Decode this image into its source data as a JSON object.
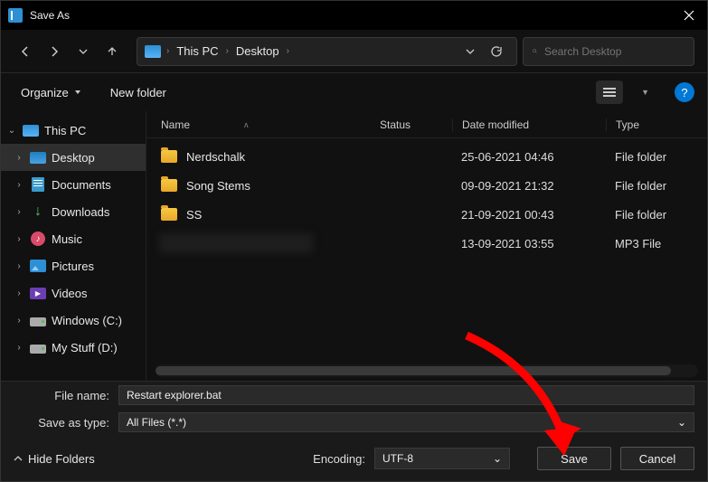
{
  "titlebar": {
    "title": "Save As"
  },
  "nav": {
    "path_seg1": "This PC",
    "path_seg2": "Desktop",
    "search_placeholder": "Search Desktop"
  },
  "toolbar": {
    "organize": "Organize",
    "newfolder": "New folder"
  },
  "sidebar": {
    "items": [
      {
        "label": "This PC"
      },
      {
        "label": "Desktop"
      },
      {
        "label": "Documents"
      },
      {
        "label": "Downloads"
      },
      {
        "label": "Music"
      },
      {
        "label": "Pictures"
      },
      {
        "label": "Videos"
      },
      {
        "label": "Windows (C:)"
      },
      {
        "label": "My Stuff (D:)"
      }
    ]
  },
  "columns": {
    "name": "Name",
    "status": "Status",
    "date": "Date modified",
    "type": "Type"
  },
  "files": [
    {
      "name": "Nerdschalk",
      "date": "25-06-2021 04:46",
      "type": "File folder",
      "icon": "folder"
    },
    {
      "name": "Song Stems",
      "date": "09-09-2021 21:32",
      "type": "File folder",
      "icon": "folder"
    },
    {
      "name": "SS",
      "date": "21-09-2021 00:43",
      "type": "File folder",
      "icon": "folder"
    },
    {
      "name": "",
      "date": "13-09-2021 03:55",
      "type": "MP3 File",
      "icon": "redact"
    }
  ],
  "footer": {
    "filename_label": "File name:",
    "filename_value": "Restart explorer.bat",
    "savetype_label": "Save as type:",
    "savetype_value": "All Files  (*.*)",
    "hidefolders": "Hide Folders",
    "encoding_label": "Encoding:",
    "encoding_value": "UTF-8",
    "save": "Save",
    "cancel": "Cancel"
  }
}
